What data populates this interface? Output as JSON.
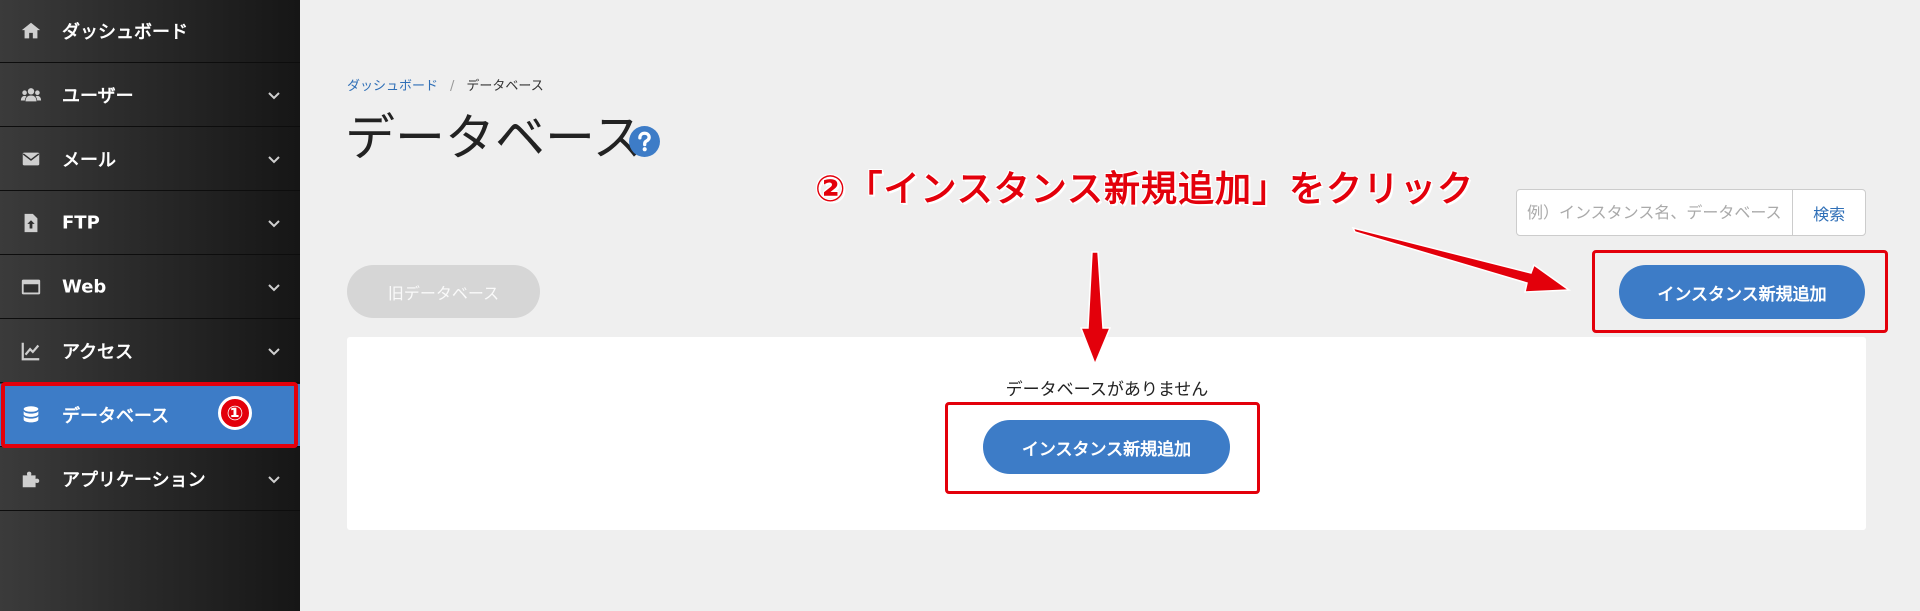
{
  "sidebar": {
    "items": [
      {
        "label": "ダッシュボード",
        "icon": "home-icon",
        "has_chevron": false
      },
      {
        "label": "ユーザー",
        "icon": "users-icon",
        "has_chevron": true
      },
      {
        "label": "メール",
        "icon": "mail-icon",
        "has_chevron": true
      },
      {
        "label": "FTP",
        "icon": "file-upload-icon",
        "has_chevron": true
      },
      {
        "label": "Web",
        "icon": "window-icon",
        "has_chevron": true
      },
      {
        "label": "アクセス",
        "icon": "chart-line-icon",
        "has_chevron": true
      },
      {
        "label": "データベース",
        "icon": "database-icon",
        "has_chevron": false,
        "active": true
      },
      {
        "label": "アプリケーション",
        "icon": "puzzle-icon",
        "has_chevron": true
      }
    ],
    "step_badge": "①"
  },
  "breadcrumb": {
    "home": "ダッシュボード",
    "separator": "/",
    "current": "データベース"
  },
  "page": {
    "title": "データベース",
    "help_icon": "question-circle-icon"
  },
  "annotation": {
    "text": "②「インスタンス新規追加」をクリック"
  },
  "search": {
    "placeholder": "例）インスタンス名、データベース名",
    "button_label": "検索"
  },
  "toolbar": {
    "old_db_label": "旧データベース",
    "add_instance_label": "インスタンス新規追加"
  },
  "empty_state": {
    "message": "データベースがありません",
    "add_instance_label": "インスタンス新規追加"
  },
  "colors": {
    "accent": "#3d7cc7",
    "annotation": "#e3000b",
    "sidebar_bg": "#2a2a2a",
    "page_bg": "#efefef"
  }
}
